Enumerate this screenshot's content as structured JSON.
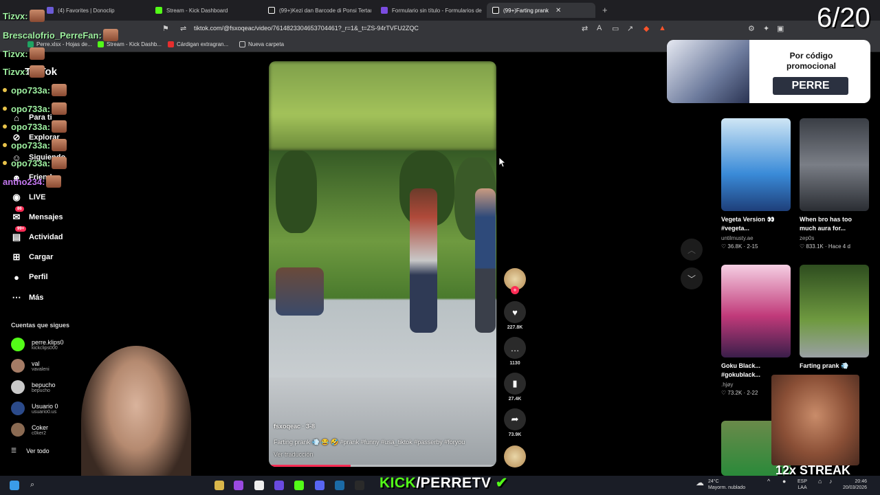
{
  "browser": {
    "tabs": [
      {
        "label": "(4) Favorites | Donoclip",
        "color": "#6b5bd6"
      },
      {
        "label": "Stream - Kick Dashboard",
        "color": "#53fc18"
      },
      {
        "label": "(99+)Kezi dan Barcode di Ponsi Tertan",
        "color": "#ffffff"
      },
      {
        "label": "Formulario sin título - Formularios de",
        "color": "#7b4ce0"
      },
      {
        "label": "(99+)Farting prank",
        "color": "#ffffff"
      }
    ],
    "url": "tiktok.com/@fsxoqeac/video/7614823304653704461?_r=1&_t=ZS-94rTVFU2ZQC",
    "bookmarks": [
      {
        "label": "Perre.xlsx - Hojas de...",
        "color": "#1fa463"
      },
      {
        "label": "Stream - Kick Dashb...",
        "color": "#53fc18"
      },
      {
        "label": "Cárdigan extragran...",
        "color": "#e62e2e"
      },
      {
        "label": "Nueva carpeta",
        "color": "#cccccc"
      }
    ]
  },
  "counter": "6/20",
  "sidebar": {
    "logo": "TikTok",
    "nav": [
      {
        "label": "Para ti",
        "icon": "home-icon"
      },
      {
        "label": "Explorar",
        "icon": "compass-icon"
      },
      {
        "label": "Siguiendo",
        "icon": "following-icon"
      },
      {
        "label": "Friends",
        "icon": "friends-icon"
      },
      {
        "label": "LIVE",
        "icon": "live-icon"
      },
      {
        "label": "Mensajes",
        "icon": "message-icon",
        "badge": "86"
      },
      {
        "label": "Actividad",
        "icon": "activity-icon",
        "badge": "99+"
      },
      {
        "label": "Cargar",
        "icon": "upload-icon"
      },
      {
        "label": "Perfil",
        "icon": "profile-icon"
      },
      {
        "label": "Más",
        "icon": "more-icon"
      }
    ],
    "following_title": "Cuentas que sigues",
    "following": [
      {
        "name": "perre.klips0",
        "handle": "kickclips000",
        "color": "#53fc18"
      },
      {
        "name": "val",
        "handle": "vavaleni",
        "color": "#a57c66"
      },
      {
        "name": "bepucho",
        "handle": "bepucho",
        "color": "#c9c9c9"
      },
      {
        "name": "Usuario 0",
        "handle": "usuario0.us",
        "color": "#2b4a8a"
      },
      {
        "name": "Coker",
        "handle": "c0ker2",
        "color": "#8a6a52"
      }
    ],
    "see_all": "Ver todo"
  },
  "chat": [
    {
      "name": "Tizvx:",
      "color": "#9ef0a0"
    },
    {
      "name": "Brescalofrio_PerreFan:",
      "color": "#9ef0a0"
    },
    {
      "name": "Tizvx:",
      "color": "#9ef0a0"
    },
    {
      "name": "Tizvx:",
      "color": "#9ef0a0"
    },
    {
      "name": "opo733a:",
      "color": "#9ef0a0"
    },
    {
      "name": "opo733a:",
      "color": "#9ef0a0"
    },
    {
      "name": "opo733a:",
      "color": "#9ef0a0"
    },
    {
      "name": "opo733a:",
      "color": "#9ef0a0"
    },
    {
      "name": "opo733a:",
      "color": "#9ef0a0"
    },
    {
      "name": "antho234:",
      "color": "#c478f0"
    }
  ],
  "video": {
    "author": "fsxoqeac",
    "date": "3-8",
    "caption": "Farting prank 💨 😂 🤣 #prank #funny #usa_tiktok #passerby #foryou",
    "translate": "Ver traducción",
    "progress": 0.36
  },
  "actions": {
    "likes": "227.8K",
    "comments": "1130",
    "saves": "27.4K",
    "shares": "73.9K"
  },
  "promo": {
    "title": "Por código promocional",
    "code": "PERRE"
  },
  "related": [
    {
      "title": "Vegeta Version 👀 #vegeta...",
      "user": "untilmusty.ae",
      "likes": "36.8K",
      "date": "2-15",
      "color": "#3a8bd8"
    },
    {
      "title": "When bro has too much aura for...",
      "user": "zep0s",
      "likes": "833.1K",
      "date": "Hace 4 d",
      "color": "#5a5e66"
    },
    {
      "title": "Goku Black... #gokublack...",
      "user": ".hjøy",
      "likes": "73.2K",
      "date": "2-22",
      "color": "#c13a7a"
    },
    {
      "title": "Farting prank 💨",
      "user": "",
      "likes": "",
      "date": "",
      "color": "#4a7a3a"
    }
  ],
  "streak": "12x STREAK",
  "kick": {
    "prefix": "KICK",
    "suffix": "/PERRETV"
  },
  "tray": {
    "weather_temp": "24°C",
    "weather_desc": "Mayorm. nublado",
    "lang": "ESP",
    "lang2": "LAA",
    "time": "20:46",
    "date": "20/03/2026"
  }
}
